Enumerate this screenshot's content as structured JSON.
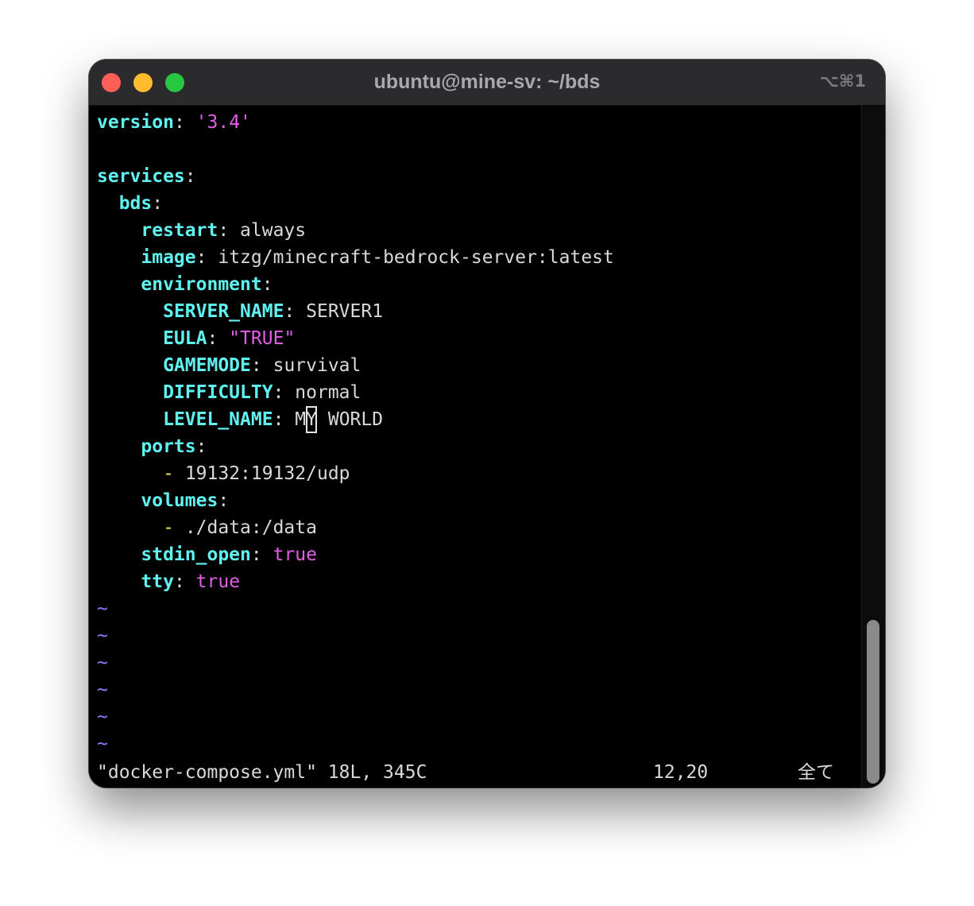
{
  "window": {
    "title": "ubuntu@mine-sv: ~/bds",
    "shortcut": "⌥⌘1"
  },
  "editor": {
    "version_key": "version",
    "version_value": "'3.4'",
    "services_key": "services",
    "service_name": "bds",
    "restart_key": "restart",
    "restart_value": "always",
    "image_key": "image",
    "image_value": "itzg/minecraft-bedrock-server:latest",
    "environment_key": "environment",
    "server_name_key": "SERVER_NAME",
    "server_name_value": "SERVER1",
    "eula_key": "EULA",
    "eula_value": "\"TRUE\"",
    "gamemode_key": "GAMEMODE",
    "gamemode_value": "survival",
    "difficulty_key": "DIFFICULTY",
    "difficulty_value": "normal",
    "level_name_key": "LEVEL_NAME",
    "level_name_before_cursor": "M",
    "level_name_cursor_char": "Y",
    "level_name_after_cursor": " WORLD",
    "ports_key": "ports",
    "ports_item": "19132:19132/udp",
    "volumes_key": "volumes",
    "volumes_item": "./data:/data",
    "stdin_key": "stdin_open",
    "stdin_value": "true",
    "tty_key": "tty",
    "tty_value": "true",
    "list_dash": "-",
    "colon": ":",
    "empty_line_marker": "~"
  },
  "status": {
    "file_info": "\"docker-compose.yml\" 18L, 345C",
    "cursor_position": "12,20",
    "scroll_position": "全て"
  },
  "colors": {
    "key": "#5ff2f0",
    "string": "#e05fe6",
    "dash": "#f3e957",
    "tilde": "#8a80ff",
    "text": "#d9d9d9",
    "background": "#000000",
    "titlebar": "#2b2b2d"
  }
}
